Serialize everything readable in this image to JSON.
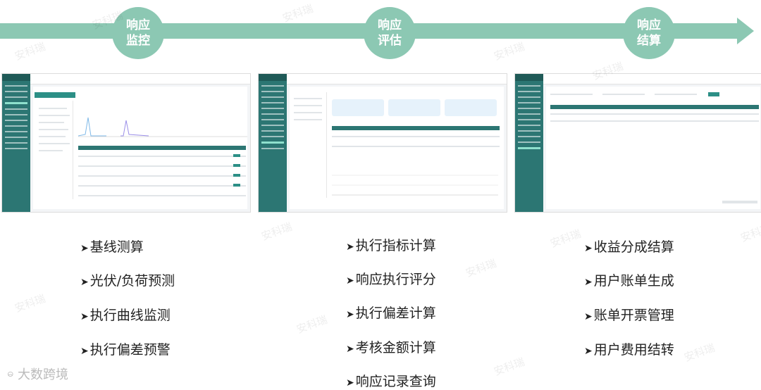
{
  "stages": [
    {
      "line1": "响应",
      "line2": "监控"
    },
    {
      "line1": "响应",
      "line2": "评估"
    },
    {
      "line1": "响应",
      "line2": "结算"
    }
  ],
  "columns": [
    {
      "features": [
        "基线测算",
        "光伏/负荷预测",
        "执行曲线监测",
        "执行偏差预警"
      ]
    },
    {
      "features": [
        "执行指标计算",
        "响应执行评分",
        "执行偏差计算",
        "考核金额计算",
        "响应记录查询"
      ]
    },
    {
      "features": [
        "收益分成结算",
        "用户账单生成",
        "账单开票管理",
        "用户费用结转"
      ]
    }
  ],
  "watermark": "安科瑞",
  "footer_logo": "大数跨境",
  "colors": {
    "band": "#8cc8b3",
    "sidebar": "#2c7673",
    "text": "#222222"
  },
  "icons": {
    "arrow_bullet": "➤",
    "footer_logo_icon": "ဓ"
  }
}
